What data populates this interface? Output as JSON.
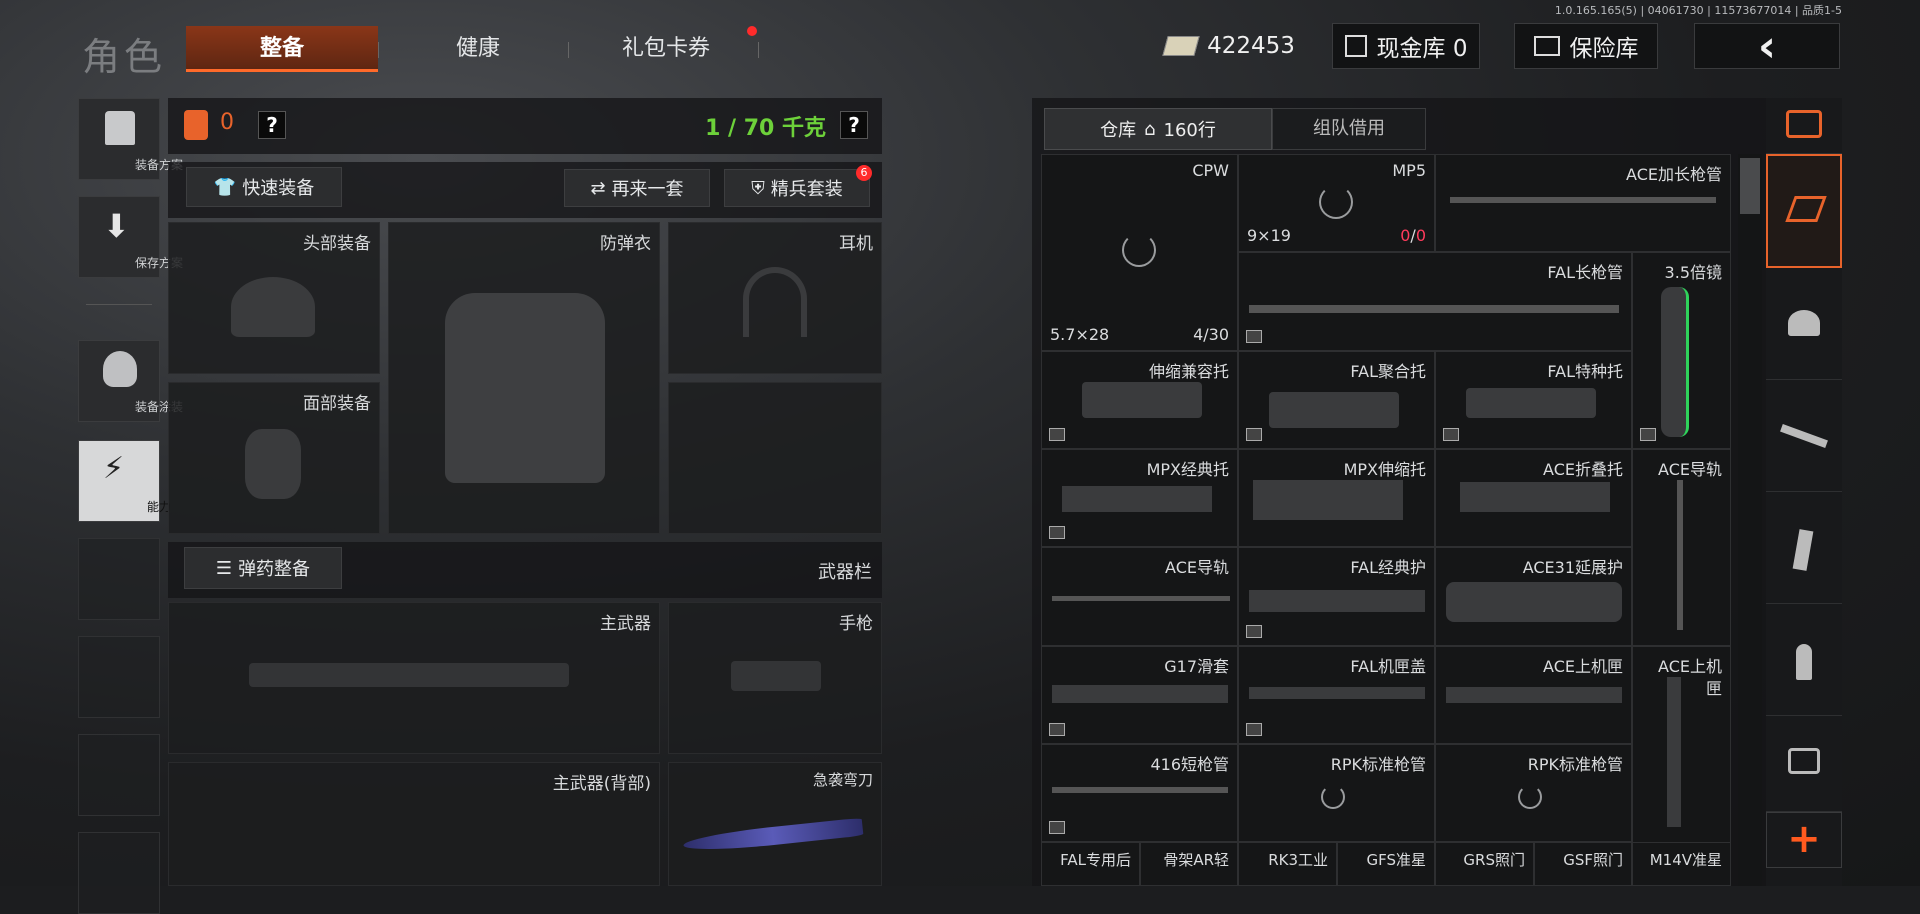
{
  "header": {
    "title": "角色",
    "tabs": [
      "整备",
      "健康",
      "礼包卡券"
    ],
    "version": "1.0.165.165(5) | 04061730 | 11573677014 | 品质1-5",
    "money": "422453",
    "cash_vault": "现金库 0",
    "insurance": "保险库",
    "back": "‹"
  },
  "sidebar": {
    "items": [
      {
        "label": "装备方案",
        "icon": "vest-icon"
      },
      {
        "label": "保存方案",
        "icon": "download-icon"
      },
      {
        "label": "装备涂装",
        "icon": "skin-icon"
      },
      {
        "label": "能力",
        "icon": "ability-icon"
      }
    ]
  },
  "loadout": {
    "armor_value": "0",
    "weight": "1 / 70 千克",
    "quick_equip": "快速装备",
    "retry": "再来一套",
    "elite": "精兵套装",
    "elite_badge": "6",
    "slots": {
      "head": "头部装备",
      "vest": "防弹衣",
      "headset": "耳机",
      "face": "面部装备"
    },
    "ammo_equip": "弹药整备",
    "weapon_bar": "武器栏",
    "weapon_slots": {
      "primary": "主武器",
      "pistol": "手枪",
      "primary_back": "主武器(背部)",
      "knife": "急袭弯刀"
    }
  },
  "warehouse": {
    "tab_storage": "仓库",
    "rows": "160行",
    "tab_team": "组队借用",
    "items": {
      "cpw": {
        "name": "CPW",
        "caliber": "5.7×28",
        "count": "4/30"
      },
      "mp5": {
        "name": "MP5",
        "caliber": "9×19",
        "count_left": "0",
        "count_right": "0"
      },
      "ace_long_barrel": "ACE加长枪管",
      "fal_long_barrel": "FAL长枪管",
      "scope": "3.5倍镜",
      "stock1": "伸缩兼容托",
      "fal_poly": "FAL聚合托",
      "fal_special": "FAL特种托",
      "mpx_classic": "MPX经典托",
      "mpx_tele": "MPX伸缩托",
      "ace_fold": "ACE折叠托",
      "ace_rail1": "ACE导轨",
      "ace_rail2": "ACE导轨",
      "fal_hand": "FAL经典护",
      "ace31": "ACE31延展护",
      "g17": "G17滑套",
      "fal_cover": "FAL机匣盖",
      "ace_upper": "ACE上机匣",
      "ace_upper2_a": "ACE上机",
      "ace_upper2_b": "匣",
      "barrel416": "416短枪管",
      "rpk1": "RPK标准枪管",
      "rpk2": "RPK标准枪管",
      "bottom": [
        "FAL专用后",
        "骨架AR轻",
        "RK3工业",
        "GFS准星",
        "GRS照门",
        "GSF照门",
        "M14V准星"
      ]
    }
  },
  "colors": {
    "accent": "#ff6a2a",
    "green": "#6dd13a",
    "red": "#ff2b2b"
  }
}
